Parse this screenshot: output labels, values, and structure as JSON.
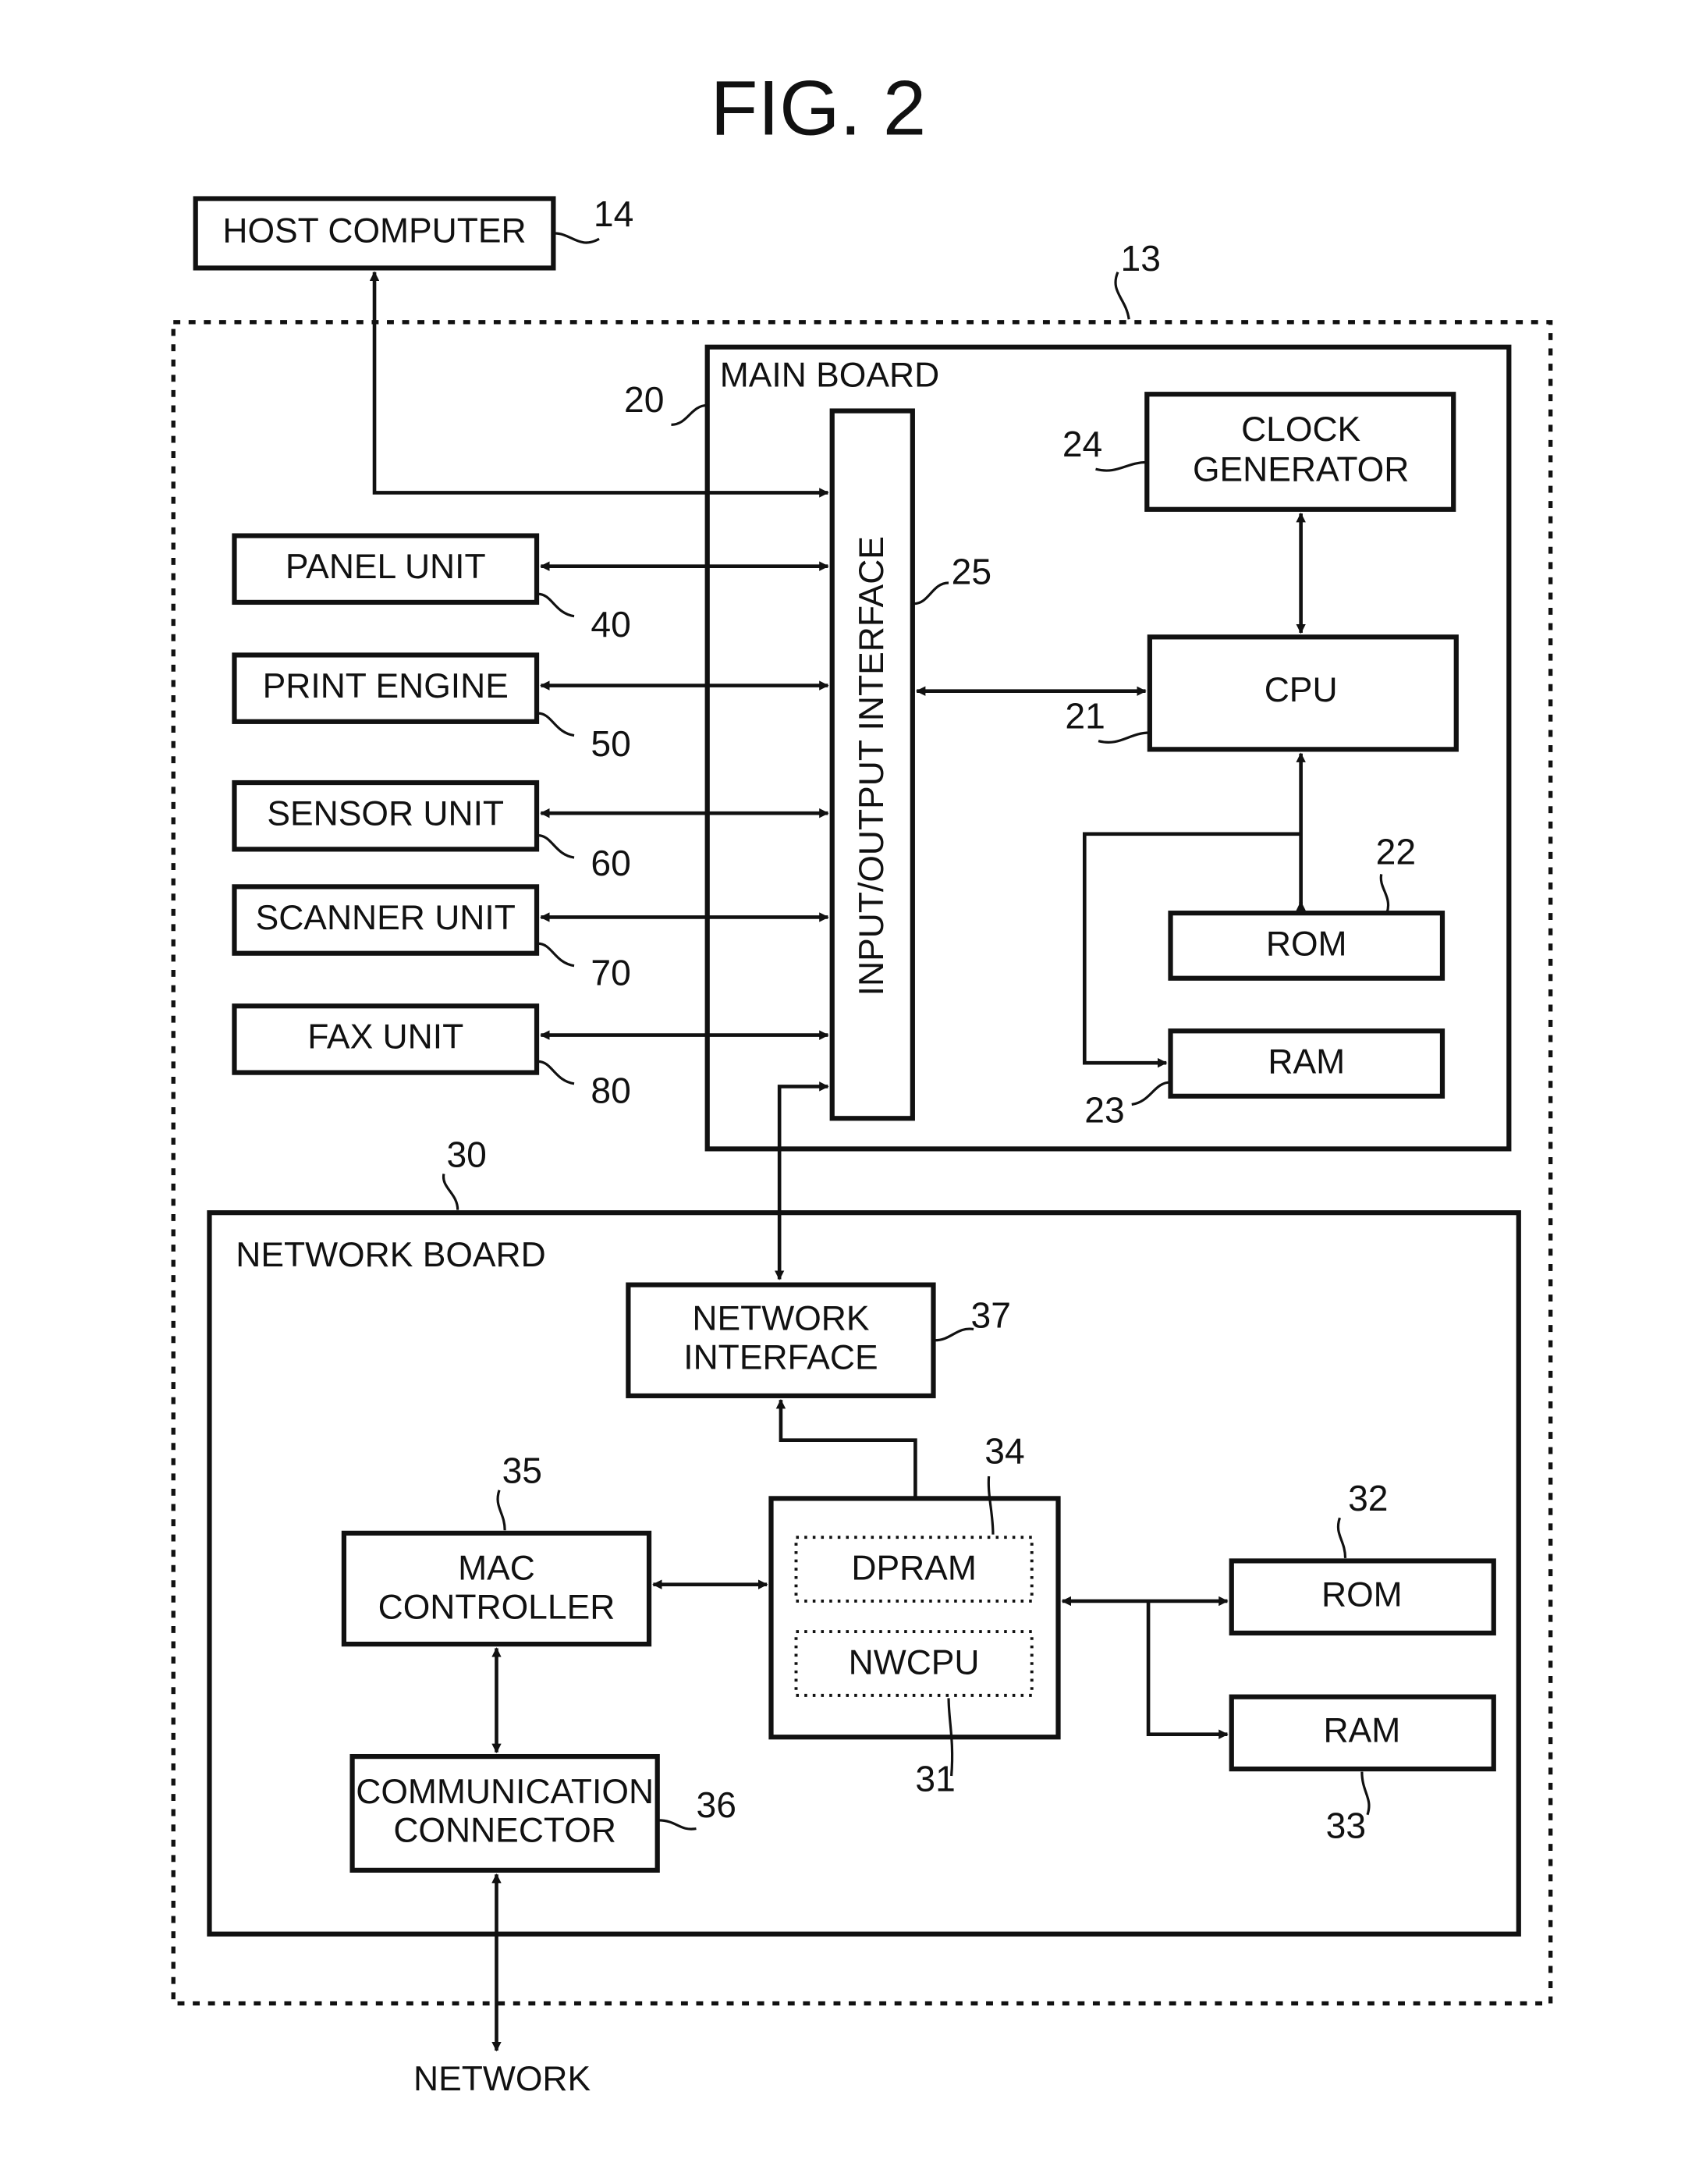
{
  "figure": {
    "title": "FIG. 2"
  },
  "host_computer": {
    "label": "HOST COMPUTER",
    "ref": "14"
  },
  "device": {
    "ref": "13"
  },
  "main_board": {
    "label": "MAIN BOARD",
    "ref": "20",
    "io_interface": {
      "label": "INPUT/OUTPUT INTERFACE",
      "ref": "25"
    },
    "clock_generator": {
      "label_line1": "CLOCK",
      "label_line2": "GENERATOR",
      "ref": "24"
    },
    "cpu": {
      "label": "CPU",
      "ref": "21"
    },
    "rom": {
      "label": "ROM",
      "ref": "22"
    },
    "ram": {
      "label": "RAM",
      "ref": "23"
    }
  },
  "peripherals": [
    {
      "label": "PANEL UNIT",
      "ref": "40"
    },
    {
      "label": "PRINT ENGINE",
      "ref": "50"
    },
    {
      "label": "SENSOR UNIT",
      "ref": "60"
    },
    {
      "label": "SCANNER UNIT",
      "ref": "70"
    },
    {
      "label": "FAX UNIT",
      "ref": "80"
    }
  ],
  "network_board": {
    "label": "NETWORK BOARD",
    "ref": "30",
    "network_interface": {
      "label_line1": "NETWORK",
      "label_line2": "INTERFACE",
      "ref": "37"
    },
    "mac_controller": {
      "label_line1": "MAC",
      "label_line2": "CONTROLLER",
      "ref": "35"
    },
    "communication_connector": {
      "label_line1": "COMMUNICATION",
      "label_line2": "CONNECTOR",
      "ref": "36"
    },
    "processor_block": {
      "dpram": {
        "label": "DPRAM",
        "ref": "34"
      },
      "nwcpu": {
        "label": "NWCPU",
        "ref": "31"
      }
    },
    "rom": {
      "label": "ROM",
      "ref": "32"
    },
    "ram": {
      "label": "RAM",
      "ref": "33"
    }
  },
  "network": {
    "label": "NETWORK"
  }
}
